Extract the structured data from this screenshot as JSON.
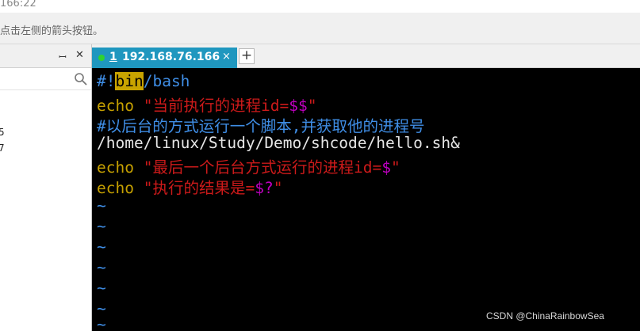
{
  "top": {
    "time": "166:22"
  },
  "hint": {
    "text": "点击左侧的箭头按钮。"
  },
  "left_panel": {
    "pin_glyph": "ꟷ",
    "close_glyph": "✕",
    "rows": [
      "5",
      "7"
    ]
  },
  "tab": {
    "number": "1",
    "host": "192.168.76.166",
    "close": "×",
    "add": "+"
  },
  "editor": {
    "line1": {
      "a": "#!",
      "b": "bin",
      "c": "/bash"
    },
    "line2": {
      "kw": "echo",
      "q1": " \"",
      "str": "当前执行的进程",
      "red": "id=",
      "var": "$$",
      "q2": "\""
    },
    "line3": "#以后台的方式运行一个脚本,并获取他的进程号",
    "line4": "/home/linux/Study/Demo/shcode/hello.sh&",
    "line5": {
      "kw": "echo",
      "q1": " \"",
      "str": "最后一个后台方式运行的进程",
      "red": "id=",
      "var": "$",
      "q2": "\""
    },
    "line6": {
      "kw": "echo",
      "q1": " \"",
      "str": "执行的结果是=",
      "var": "$?",
      "q2": "\""
    },
    "tilde": "~"
  },
  "watermark": "CSDN @ChinaRainbowSea"
}
